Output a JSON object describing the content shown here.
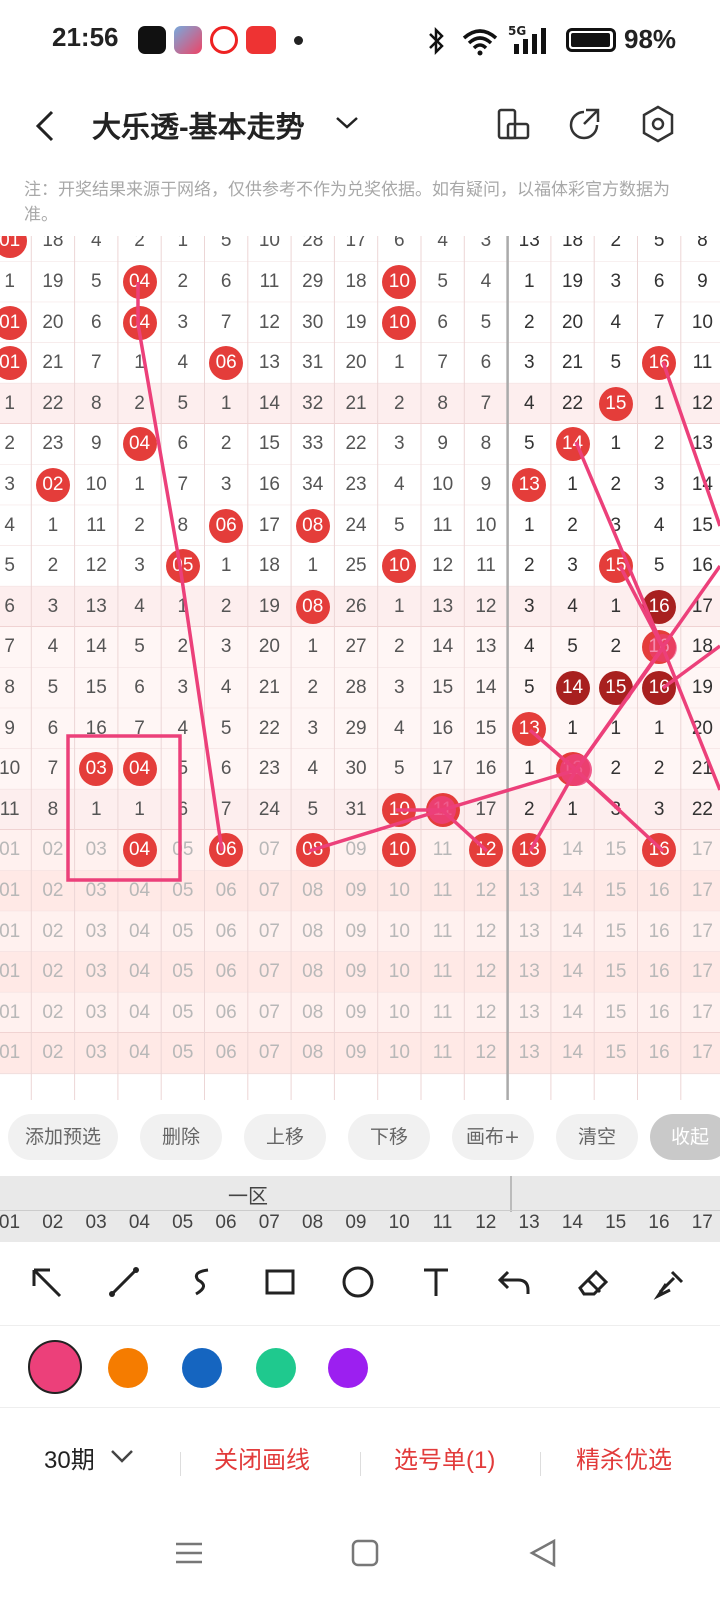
{
  "status_bar": {
    "time": "21:56",
    "network": "5G",
    "battery": "98%",
    "battery_level": 0.98
  },
  "header": {
    "title": "大乐透-基本走势"
  },
  "notice": "注：开奖结果来源于网络，仅供参考不作为兑奖依据。如有疑问，以福体彩官方数据为准。",
  "grid": {
    "rows": [
      [
        "01",
        "18",
        "4",
        "2",
        "1",
        "5",
        "10",
        "28",
        "17",
        "6",
        "4",
        "3",
        "13",
        "18",
        "2",
        "5",
        "8"
      ],
      [
        "1",
        "19",
        "5",
        "04",
        "2",
        "6",
        "11",
        "29",
        "18",
        "10",
        "5",
        "4",
        "1",
        "19",
        "3",
        "6",
        "9"
      ],
      [
        "01",
        "20",
        "6",
        "04",
        "3",
        "7",
        "12",
        "30",
        "19",
        "10",
        "6",
        "5",
        "2",
        "20",
        "4",
        "7",
        "10"
      ],
      [
        "01",
        "21",
        "7",
        "1",
        "4",
        "06",
        "13",
        "31",
        "20",
        "1",
        "7",
        "6",
        "3",
        "21",
        "5",
        "16",
        "11"
      ],
      [
        "1",
        "22",
        "8",
        "2",
        "5",
        "1",
        "14",
        "32",
        "21",
        "2",
        "8",
        "7",
        "4",
        "22",
        "15",
        "1",
        "12"
      ],
      [
        "2",
        "23",
        "9",
        "04",
        "6",
        "2",
        "15",
        "33",
        "22",
        "3",
        "9",
        "8",
        "5",
        "14",
        "1",
        "2",
        "13"
      ],
      [
        "3",
        "02",
        "10",
        "1",
        "7",
        "3",
        "16",
        "34",
        "23",
        "4",
        "10",
        "9",
        "13",
        "1",
        "2",
        "3",
        "14"
      ],
      [
        "4",
        "1",
        "11",
        "2",
        "8",
        "06",
        "17",
        "08",
        "24",
        "5",
        "11",
        "10",
        "1",
        "2",
        "3",
        "4",
        "15"
      ],
      [
        "5",
        "2",
        "12",
        "3",
        "05",
        "1",
        "18",
        "1",
        "25",
        "10",
        "12",
        "11",
        "2",
        "3",
        "15",
        "5",
        "16"
      ],
      [
        "6",
        "3",
        "13",
        "4",
        "1",
        "2",
        "19",
        "08",
        "26",
        "1",
        "13",
        "12",
        "3",
        "4",
        "1",
        "16",
        "17"
      ],
      [
        "7",
        "4",
        "14",
        "5",
        "2",
        "3",
        "20",
        "1",
        "27",
        "2",
        "14",
        "13",
        "4",
        "5",
        "2",
        "16",
        "18"
      ],
      [
        "8",
        "5",
        "15",
        "6",
        "3",
        "4",
        "21",
        "2",
        "28",
        "3",
        "15",
        "14",
        "5",
        "14",
        "15",
        "16",
        "19"
      ],
      [
        "9",
        "6",
        "16",
        "7",
        "4",
        "5",
        "22",
        "3",
        "29",
        "4",
        "16",
        "15",
        "13",
        "1",
        "1",
        "1",
        "20"
      ],
      [
        "10",
        "7",
        "03",
        "04",
        "5",
        "6",
        "23",
        "4",
        "30",
        "5",
        "17",
        "16",
        "1",
        "13",
        "2",
        "2",
        "21"
      ],
      [
        "11",
        "8",
        "1",
        "1",
        "6",
        "7",
        "24",
        "5",
        "31",
        "10",
        "11",
        "17",
        "2",
        "1",
        "3",
        "3",
        "22"
      ],
      [
        "01",
        "02",
        "03",
        "04",
        "05",
        "06",
        "07",
        "08",
        "09",
        "10",
        "11",
        "12",
        "13",
        "14",
        "15",
        "16",
        "17"
      ],
      [
        "01",
        "02",
        "03",
        "04",
        "05",
        "06",
        "07",
        "08",
        "09",
        "10",
        "11",
        "12",
        "13",
        "14",
        "15",
        "16",
        "17"
      ],
      [
        "01",
        "02",
        "03",
        "04",
        "05",
        "06",
        "07",
        "08",
        "09",
        "10",
        "11",
        "12",
        "13",
        "14",
        "15",
        "16",
        "17"
      ],
      [
        "01",
        "02",
        "03",
        "04",
        "05",
        "06",
        "07",
        "08",
        "09",
        "10",
        "11",
        "12",
        "13",
        "14",
        "15",
        "16",
        "17"
      ],
      [
        "01",
        "02",
        "03",
        "04",
        "05",
        "06",
        "07",
        "08",
        "09",
        "10",
        "11",
        "12",
        "13",
        "14",
        "15",
        "16",
        "17"
      ],
      [
        "01",
        "02",
        "03",
        "04",
        "05",
        "06",
        "07",
        "08",
        "09",
        "10",
        "11",
        "12",
        "13",
        "14",
        "15",
        "16",
        "17"
      ]
    ],
    "balls": [
      [
        0,
        0
      ],
      [
        1,
        3
      ],
      [
        1,
        9
      ],
      [
        2,
        0
      ],
      [
        2,
        3
      ],
      [
        2,
        9
      ],
      [
        3,
        0
      ],
      [
        3,
        5
      ],
      [
        3,
        15
      ],
      [
        4,
        14
      ],
      [
        5,
        3
      ],
      [
        5,
        13
      ],
      [
        6,
        1
      ],
      [
        6,
        12
      ],
      [
        7,
        5
      ],
      [
        7,
        7
      ],
      [
        8,
        4
      ],
      [
        8,
        9
      ],
      [
        8,
        14
      ],
      [
        9,
        7
      ],
      [
        9,
        15
      ],
      [
        10,
        15
      ],
      [
        11,
        13
      ],
      [
        11,
        14
      ],
      [
        11,
        15
      ],
      [
        12,
        12
      ],
      [
        13,
        2
      ],
      [
        13,
        3
      ],
      [
        13,
        13
      ],
      [
        14,
        9
      ],
      [
        14,
        10
      ],
      [
        15,
        3
      ],
      [
        15,
        5
      ],
      [
        15,
        7
      ],
      [
        15,
        9
      ],
      [
        15,
        11
      ],
      [
        15,
        12
      ],
      [
        15,
        15
      ]
    ],
    "dark_balls": [
      [
        9,
        15
      ],
      [
        11,
        13
      ],
      [
        11,
        14
      ],
      [
        11,
        15
      ]
    ]
  },
  "action_buttons": [
    "添加预选",
    "删除",
    "上移",
    "下移",
    "画布+",
    "清空",
    "收起"
  ],
  "column_header": {
    "zone": "一区",
    "numbers": [
      "01",
      "02",
      "03",
      "04",
      "05",
      "06",
      "07",
      "08",
      "09",
      "10",
      "11",
      "12",
      "13",
      "14",
      "15",
      "16",
      "17"
    ]
  },
  "drawing_tools": [
    "arrow-tool-icon",
    "line-tool-icon",
    "curve-tool-icon",
    "rectangle-tool-icon",
    "circle-tool-icon",
    "text-tool-icon",
    "undo-icon",
    "eraser-icon",
    "clear-brush-icon"
  ],
  "colors": [
    "#ec407a",
    "#f57c00",
    "#1565c0",
    "#1fc98e",
    "#9c1ff0"
  ],
  "bottom_bar": {
    "period": "30期",
    "close_draw": "关闭画线",
    "pick_list": "选号单(1)",
    "elite": "精杀优选"
  }
}
